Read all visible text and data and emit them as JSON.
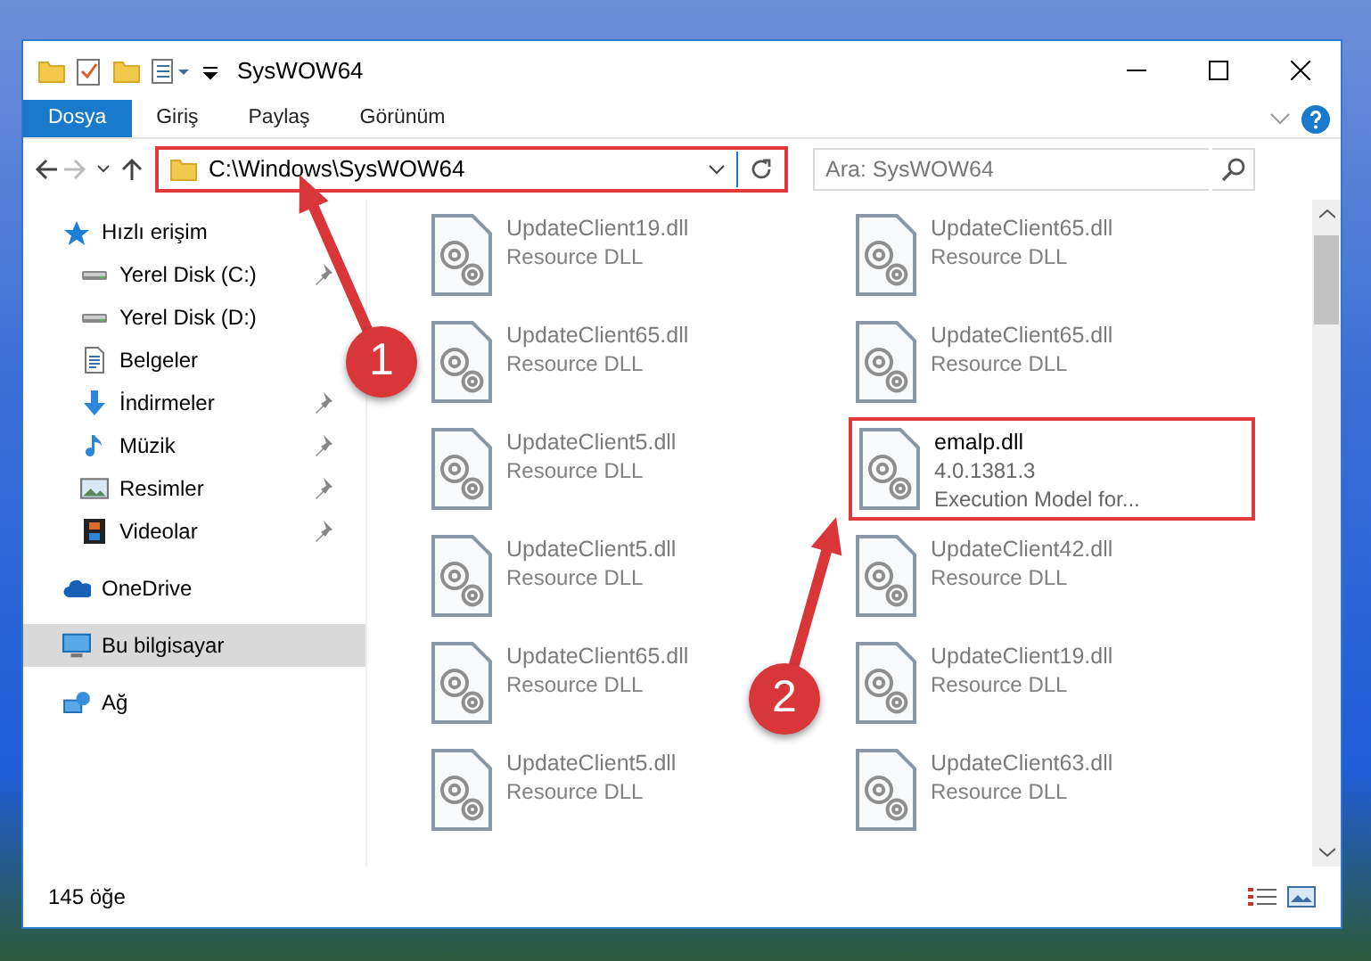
{
  "window": {
    "title": "SysWOW64"
  },
  "ribbon_tabs": [
    {
      "label": "Dosya",
      "selected": true
    },
    {
      "label": "Giriş",
      "selected": false
    },
    {
      "label": "Paylaş",
      "selected": false
    },
    {
      "label": "Görünüm",
      "selected": false
    }
  ],
  "address_bar": {
    "path": "C:\\Windows\\SysWOW64",
    "highlighted": true
  },
  "search": {
    "placeholder": "Ara: SysWOW64"
  },
  "sidebar": {
    "items": [
      {
        "label": "Hızlı erişim",
        "kind": "star",
        "selected": false,
        "children": [
          {
            "label": "Yerel Disk (C:)",
            "kind": "drive",
            "pinned": true,
            "selected": false
          },
          {
            "label": "Yerel Disk (D:)",
            "kind": "drive",
            "pinned": false,
            "selected": false
          },
          {
            "label": "Belgeler",
            "kind": "document",
            "pinned": false,
            "selected": false
          },
          {
            "label": "İndirmeler",
            "kind": "download",
            "pinned": true,
            "selected": false
          },
          {
            "label": "Müzik",
            "kind": "music",
            "pinned": true,
            "selected": false
          },
          {
            "label": "Resimler",
            "kind": "picture",
            "pinned": true,
            "selected": false
          },
          {
            "label": "Videolar",
            "kind": "video",
            "pinned": true,
            "selected": false
          }
        ]
      },
      {
        "label": "OneDrive",
        "kind": "cloud",
        "selected": false
      },
      {
        "label": "Bu bilgisayar",
        "kind": "computer",
        "selected": true
      },
      {
        "label": "Ağ",
        "kind": "network",
        "selected": false
      }
    ]
  },
  "files": [
    {
      "name": "UpdateClient19.dll",
      "details": [
        "Resource DLL"
      ],
      "dimmed": true,
      "highlighted": false
    },
    {
      "name": "UpdateClient65.dll",
      "details": [
        "Resource DLL"
      ],
      "dimmed": true,
      "highlighted": false
    },
    {
      "name": "UpdateClient5.dll",
      "details": [
        "Resource DLL"
      ],
      "dimmed": true,
      "highlighted": false
    },
    {
      "name": "UpdateClient5.dll",
      "details": [
        "Resource DLL"
      ],
      "dimmed": true,
      "highlighted": false
    },
    {
      "name": "UpdateClient65.dll",
      "details": [
        "Resource DLL"
      ],
      "dimmed": true,
      "highlighted": false
    },
    {
      "name": "UpdateClient5.dll",
      "details": [
        "Resource DLL"
      ],
      "dimmed": true,
      "highlighted": false
    },
    {
      "name": "UpdateClient65.dll",
      "details": [
        "Resource DLL"
      ],
      "dimmed": true,
      "highlighted": false
    },
    {
      "name": "UpdateClient65.dll",
      "details": [
        "Resource DLL"
      ],
      "dimmed": true,
      "highlighted": false
    },
    {
      "name": "emalp.dll",
      "details": [
        "4.0.1381.3",
        "Execution Model for..."
      ],
      "dimmed": false,
      "highlighted": true
    },
    {
      "name": "UpdateClient42.dll",
      "details": [
        "Resource DLL"
      ],
      "dimmed": true,
      "highlighted": false
    },
    {
      "name": "UpdateClient19.dll",
      "details": [
        "Resource DLL"
      ],
      "dimmed": true,
      "highlighted": false
    },
    {
      "name": "UpdateClient63.dll",
      "details": [
        "Resource DLL"
      ],
      "dimmed": true,
      "highlighted": false
    }
  ],
  "status_bar": {
    "item_count": "145 öğe"
  },
  "annotations": [
    {
      "label": "1"
    },
    {
      "label": "2"
    }
  ]
}
